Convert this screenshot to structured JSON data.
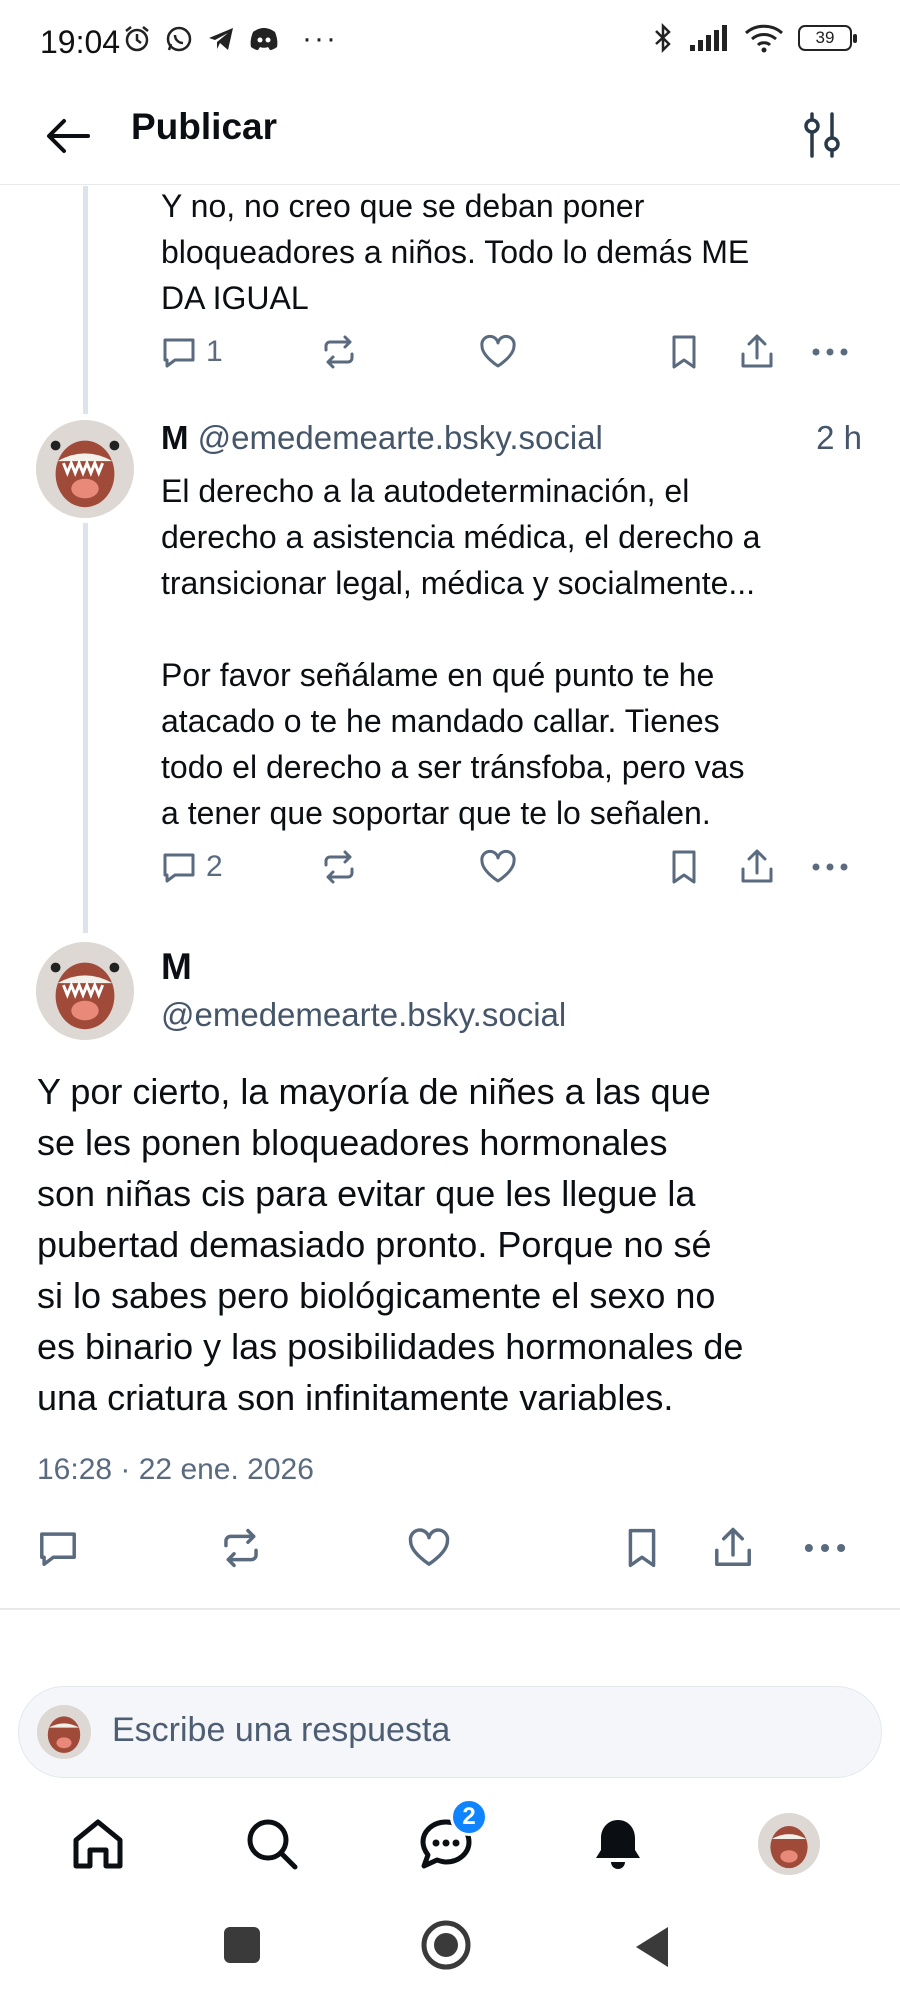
{
  "status_bar": {
    "time": "19:04",
    "battery": "39",
    "more_dots": "···"
  },
  "header": {
    "title": "Publicar"
  },
  "parent_post": {
    "text_lines": [
      "Y no, no creo que se deban poner",
      "bloqueadores a niños. Todo lo demás ME",
      "DA IGUAL"
    ],
    "reply_count": "1"
  },
  "reply_post": {
    "name": "M",
    "handle": "@emedemearte.bsky.social",
    "time_ago": "2 h",
    "text_lines": [
      "El derecho a la autodeterminación, el",
      "derecho a asistencia médica, el derecho a",
      "transicionar legal, médica y socialmente...",
      "",
      "Por favor señálame en qué punto te he",
      "atacado o te he mandado callar. Tienes",
      "todo el derecho a ser tránsfoba, pero vas",
      "a tener que soportar que te lo señalen."
    ],
    "reply_count": "2"
  },
  "main_post": {
    "name": "M",
    "handle": "@emedemearte.bsky.social",
    "text_lines": [
      "Y por cierto, la mayoría de niñes a las que",
      "se les ponen bloqueadores hormonales",
      "son niñas cis para evitar que les llegue la",
      "pubertad demasiado pronto. Porque no sé",
      "si lo sabes pero biológicamente el sexo no",
      "es binario y las posibilidades hormonales de",
      "una criatura son infinitamente variables."
    ],
    "timestamp": "16:28 · 22 ene. 2026"
  },
  "reply_input": {
    "placeholder": "Escribe una respuesta"
  },
  "bottom_nav": {
    "chat_badge": "2"
  },
  "colors": {
    "accent": "#1083fe",
    "muted": "#5a6b7f",
    "thread_line": "#dde3ea"
  }
}
